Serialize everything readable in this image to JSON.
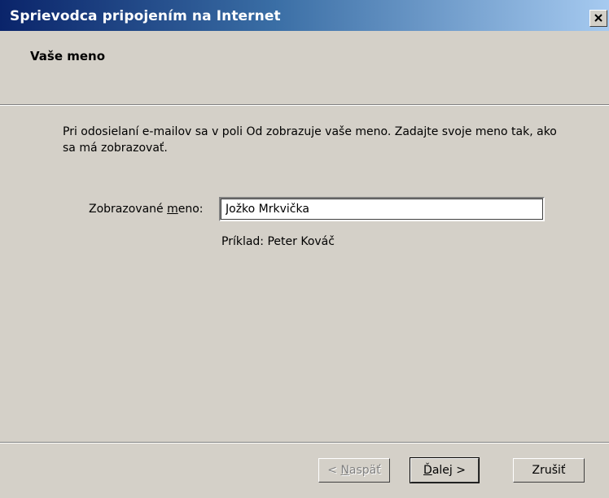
{
  "window": {
    "title": "Sprievodca pripojením na Internet"
  },
  "header": {
    "title": "Vaše meno"
  },
  "main": {
    "description": "Pri odosielaní e-mailov sa v poli Od zobrazuje vaše meno. Zadajte svoje meno tak, ako sa má zobrazovať.",
    "display_name_label_pre": "Zobrazované ",
    "display_name_label_accel": "m",
    "display_name_label_post": "eno:",
    "display_name_value": "Jožko Mrkvička",
    "example": "Príklad: Peter Kováč"
  },
  "buttons": {
    "back_pre": "< ",
    "back_accel": "N",
    "back_post": "aspäť",
    "next_accel": "Ď",
    "next_post": "alej >",
    "cancel": "Zrušiť"
  }
}
